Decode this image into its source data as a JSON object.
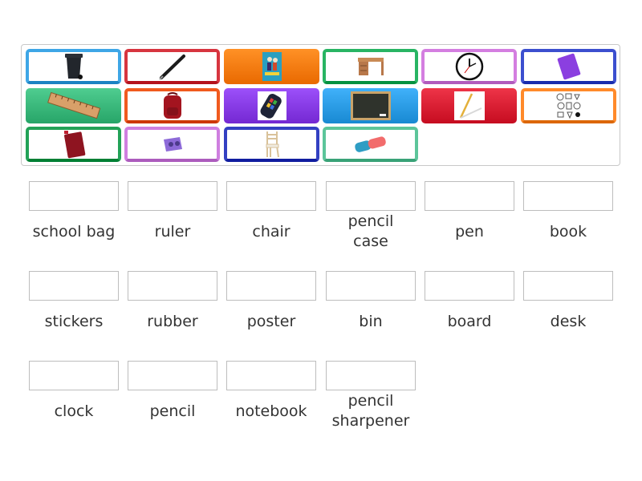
{
  "cards": [
    {
      "icon": "trash-bin-icon",
      "color": "#3ea6e6",
      "style": "outline"
    },
    {
      "icon": "pen-icon",
      "color": "#d7353f",
      "style": "outline"
    },
    {
      "icon": "poster-icon",
      "color": "#ff7f14",
      "style": "filled"
    },
    {
      "icon": "desk-icon",
      "color": "#28b463",
      "style": "outline"
    },
    {
      "icon": "clock-icon",
      "color": "#d47ee0",
      "style": "outline"
    },
    {
      "icon": "notebook-icon",
      "color": "#3c4fcf",
      "style": "outline"
    },
    {
      "icon": "ruler-icon",
      "color": "#3dbb7e",
      "style": "filled"
    },
    {
      "icon": "school-bag-icon",
      "color": "#f05a1e",
      "style": "outline"
    },
    {
      "icon": "pencil-case-icon",
      "color": "#8a3ee8",
      "style": "filled"
    },
    {
      "icon": "board-icon",
      "color": "#2e9fe8",
      "style": "filled"
    },
    {
      "icon": "pencil-icon",
      "color": "#dc2236",
      "style": "filled"
    },
    {
      "icon": "stickers-icon",
      "color": "#ff8a2a",
      "style": "outline"
    },
    {
      "icon": "book-icon",
      "color": "#22a257",
      "style": "outline"
    },
    {
      "icon": "pencil-sharpener-icon",
      "color": "#cf7fe0",
      "style": "outline"
    },
    {
      "icon": "chair-icon",
      "color": "#3340c2",
      "style": "outline"
    },
    {
      "icon": "rubber-icon",
      "color": "#5cc59a",
      "style": "outline"
    }
  ],
  "slots": [
    {
      "label": "school bag"
    },
    {
      "label": "ruler"
    },
    {
      "label": "chair"
    },
    {
      "label": "pencil\ncase"
    },
    {
      "label": "pen"
    },
    {
      "label": "book"
    },
    {
      "label": "stickers"
    },
    {
      "label": "rubber"
    },
    {
      "label": "poster"
    },
    {
      "label": "bin"
    },
    {
      "label": "board"
    },
    {
      "label": "desk"
    },
    {
      "label": "clock"
    },
    {
      "label": "pencil"
    },
    {
      "label": "notebook"
    },
    {
      "label": "pencil\nsharpener"
    }
  ]
}
